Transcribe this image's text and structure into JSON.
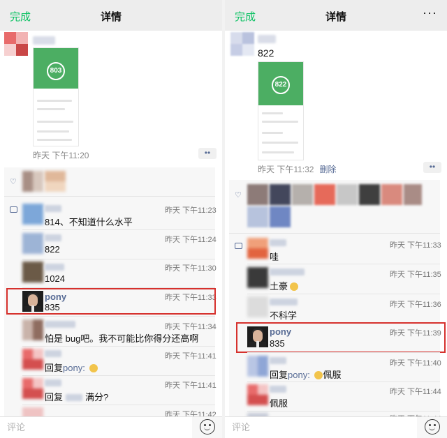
{
  "left": {
    "navbar": {
      "done": "完成",
      "title": "详情"
    },
    "post": {
      "badge_value": "803",
      "meta_time": "昨天 下午11:20",
      "more_icon": "more-dots-icon"
    },
    "comments": [
      {
        "time": "昨天 下午11:23",
        "text": "814、不知道什么水平"
      },
      {
        "time": "昨天 下午11:24",
        "text": "822"
      },
      {
        "time": "昨天 下午11:30",
        "text": "1024"
      },
      {
        "name": "pony",
        "time": "昨天 下午11:33",
        "text": "835",
        "highlighted": true
      },
      {
        "time": "昨天 下午11:34",
        "text": "怕是 bug吧。我不可能比你得分还高啊"
      },
      {
        "time": "昨天 下午11:41",
        "reply_prefix": "回复",
        "reply_name": "pony",
        "reply_sep": ":",
        "emoji": "smirk-emoji"
      },
      {
        "time": "昨天 下午11:41",
        "reply_prefix": "回复",
        "text": "满分?"
      },
      {
        "time": "昨天 下午11:42"
      }
    ],
    "input_placeholder": "评论"
  },
  "right": {
    "navbar": {
      "done": "完成",
      "title": "详情",
      "more": "···"
    },
    "post": {
      "text": "822",
      "badge_value": "822",
      "meta_time": "昨天 下午11:32",
      "delete_label": "删除"
    },
    "comments": [
      {
        "time": "昨天 下午11:33",
        "text": "哇"
      },
      {
        "time": "昨天 下午11:35",
        "text": "土豪",
        "emoji": "grin-emoji"
      },
      {
        "time": "昨天 下午11:36",
        "text": "不科学"
      },
      {
        "name": "pony",
        "time": "昨天 下午11:39",
        "text": "835",
        "highlighted": true
      },
      {
        "time": "昨天 下午11:40",
        "reply_prefix": "回复",
        "reply_name": "pony",
        "reply_sep": ":",
        "emoji": "sweat-emoji",
        "text": "佩服"
      },
      {
        "time": "昨天 下午11:44",
        "text": "佩服"
      },
      {
        "time": "昨天 下午11:44"
      }
    ],
    "input_placeholder": "评论"
  },
  "colors": {
    "accent_green": "#07c160",
    "link_blue": "#576b95",
    "highlight_red": "#d6312d"
  }
}
